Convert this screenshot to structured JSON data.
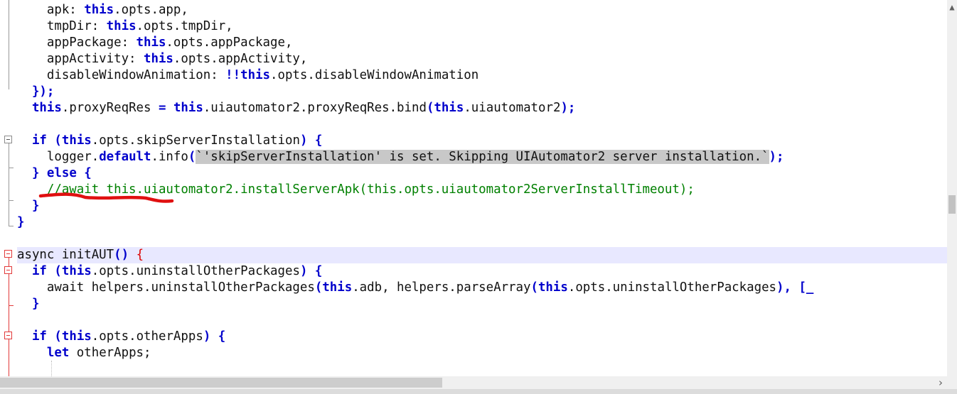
{
  "editor": {
    "lines": [
      {
        "indent": "    ",
        "tokens": [
          {
            "t": "apk: "
          },
          {
            "t": "this",
            "c": "kw"
          },
          {
            "t": ".opts.app,"
          }
        ]
      },
      {
        "indent": "    ",
        "tokens": [
          {
            "t": "tmpDir: "
          },
          {
            "t": "this",
            "c": "kw"
          },
          {
            "t": ".opts.tmpDir,"
          }
        ]
      },
      {
        "indent": "    ",
        "tokens": [
          {
            "t": "appPackage: "
          },
          {
            "t": "this",
            "c": "kw"
          },
          {
            "t": ".opts.appPackage,"
          }
        ]
      },
      {
        "indent": "    ",
        "tokens": [
          {
            "t": "appActivity: "
          },
          {
            "t": "this",
            "c": "kw"
          },
          {
            "t": ".opts.appActivity,"
          }
        ]
      },
      {
        "indent": "    ",
        "tokens": [
          {
            "t": "disableWindowAnimation: "
          },
          {
            "t": "!!",
            "c": "kw"
          },
          {
            "t": "this",
            "c": "kw"
          },
          {
            "t": ".opts.disableWindowAnimation"
          }
        ]
      },
      {
        "indent": "  ",
        "tokens": [
          {
            "t": "});",
            "c": "kw"
          }
        ]
      },
      {
        "indent": "  ",
        "tokens": [
          {
            "t": "this",
            "c": "kw"
          },
          {
            "t": ".proxyReqRes "
          },
          {
            "t": "=",
            "c": "kw"
          },
          {
            "t": " "
          },
          {
            "t": "this",
            "c": "kw"
          },
          {
            "t": ".uiautomator2.proxyReqRes.bind"
          },
          {
            "t": "(",
            "c": "kw"
          },
          {
            "t": "this",
            "c": "kw"
          },
          {
            "t": ".uiautomator2"
          },
          {
            "t": ");",
            "c": "kw"
          }
        ]
      },
      {
        "indent": "",
        "tokens": []
      },
      {
        "indent": "  ",
        "tokens": [
          {
            "t": "if",
            "c": "kw"
          },
          {
            "t": " "
          },
          {
            "t": "(",
            "c": "kw"
          },
          {
            "t": "this",
            "c": "kw"
          },
          {
            "t": ".opts.skipServerInstallation"
          },
          {
            "t": ")",
            "c": "kw"
          },
          {
            "t": " "
          },
          {
            "t": "{",
            "c": "kw"
          }
        ]
      },
      {
        "indent": "    ",
        "tokens": [
          {
            "t": "logger."
          },
          {
            "t": "default",
            "c": "kw"
          },
          {
            "t": ".info"
          },
          {
            "t": "(",
            "c": "kw"
          },
          {
            "t": "`'skipServerInstallation' is set. Skipping UIAutomator2 server installation.`",
            "c": "hl"
          },
          {
            "t": ");",
            "c": "kw"
          }
        ]
      },
      {
        "indent": "  ",
        "tokens": [
          {
            "t": "}",
            "c": "kw"
          },
          {
            "t": " "
          },
          {
            "t": "else",
            "c": "kw"
          },
          {
            "t": " "
          },
          {
            "t": "{",
            "c": "kw"
          }
        ]
      },
      {
        "indent": "    ",
        "tokens": [
          {
            "t": "//await this.uiautomator2.installServerApk(this.opts.uiautomator2ServerInstallTimeout);",
            "c": "cm"
          }
        ]
      },
      {
        "indent": "  ",
        "tokens": [
          {
            "t": "}",
            "c": "kw"
          }
        ]
      },
      {
        "indent": "",
        "tokens": [
          {
            "t": "}",
            "c": "kw"
          }
        ]
      },
      {
        "indent": "",
        "tokens": []
      },
      {
        "indent": "",
        "current": true,
        "tokens": [
          {
            "t": "async initAUT"
          },
          {
            "t": "()",
            "c": "kw"
          },
          {
            "t": " "
          },
          {
            "t": "{",
            "c": "brace-red"
          }
        ]
      },
      {
        "indent": "  ",
        "tokens": [
          {
            "t": "if",
            "c": "kw"
          },
          {
            "t": " "
          },
          {
            "t": "(",
            "c": "kw"
          },
          {
            "t": "this",
            "c": "kw"
          },
          {
            "t": ".opts.uninstallOtherPackages"
          },
          {
            "t": ")",
            "c": "kw"
          },
          {
            "t": " "
          },
          {
            "t": "{",
            "c": "kw"
          }
        ]
      },
      {
        "indent": "    ",
        "tokens": [
          {
            "t": "await helpers.uninstallOtherPackages"
          },
          {
            "t": "(",
            "c": "kw"
          },
          {
            "t": "this",
            "c": "kw"
          },
          {
            "t": ".adb, helpers.parseArray"
          },
          {
            "t": "(",
            "c": "kw"
          },
          {
            "t": "this",
            "c": "kw"
          },
          {
            "t": ".opts.uninstallOtherPackages"
          },
          {
            "t": "),",
            "c": "kw"
          },
          {
            "t": " "
          },
          {
            "t": "[_",
            "c": "kw"
          }
        ]
      },
      {
        "indent": "  ",
        "tokens": [
          {
            "t": "}",
            "c": "kw"
          }
        ]
      },
      {
        "indent": "",
        "tokens": []
      },
      {
        "indent": "  ",
        "tokens": [
          {
            "t": "if",
            "c": "kw"
          },
          {
            "t": " "
          },
          {
            "t": "(",
            "c": "kw"
          },
          {
            "t": "this",
            "c": "kw"
          },
          {
            "t": ".opts.otherApps"
          },
          {
            "t": ")",
            "c": "kw"
          },
          {
            "t": " "
          },
          {
            "t": "{",
            "c": "kw"
          }
        ]
      },
      {
        "indent": "    ",
        "tokens": [
          {
            "t": "let",
            "c": "kw"
          },
          {
            "t": " otherApps;"
          }
        ]
      }
    ]
  },
  "icons": {
    "scroll_up": "▲",
    "scroll_right": "›"
  },
  "colors": {
    "keyword": "#0000cc",
    "comment": "#008000",
    "current_line": "#e8e8ff",
    "string_highlight": "#c8c8c8",
    "annotation_stroke": "#e01010"
  }
}
